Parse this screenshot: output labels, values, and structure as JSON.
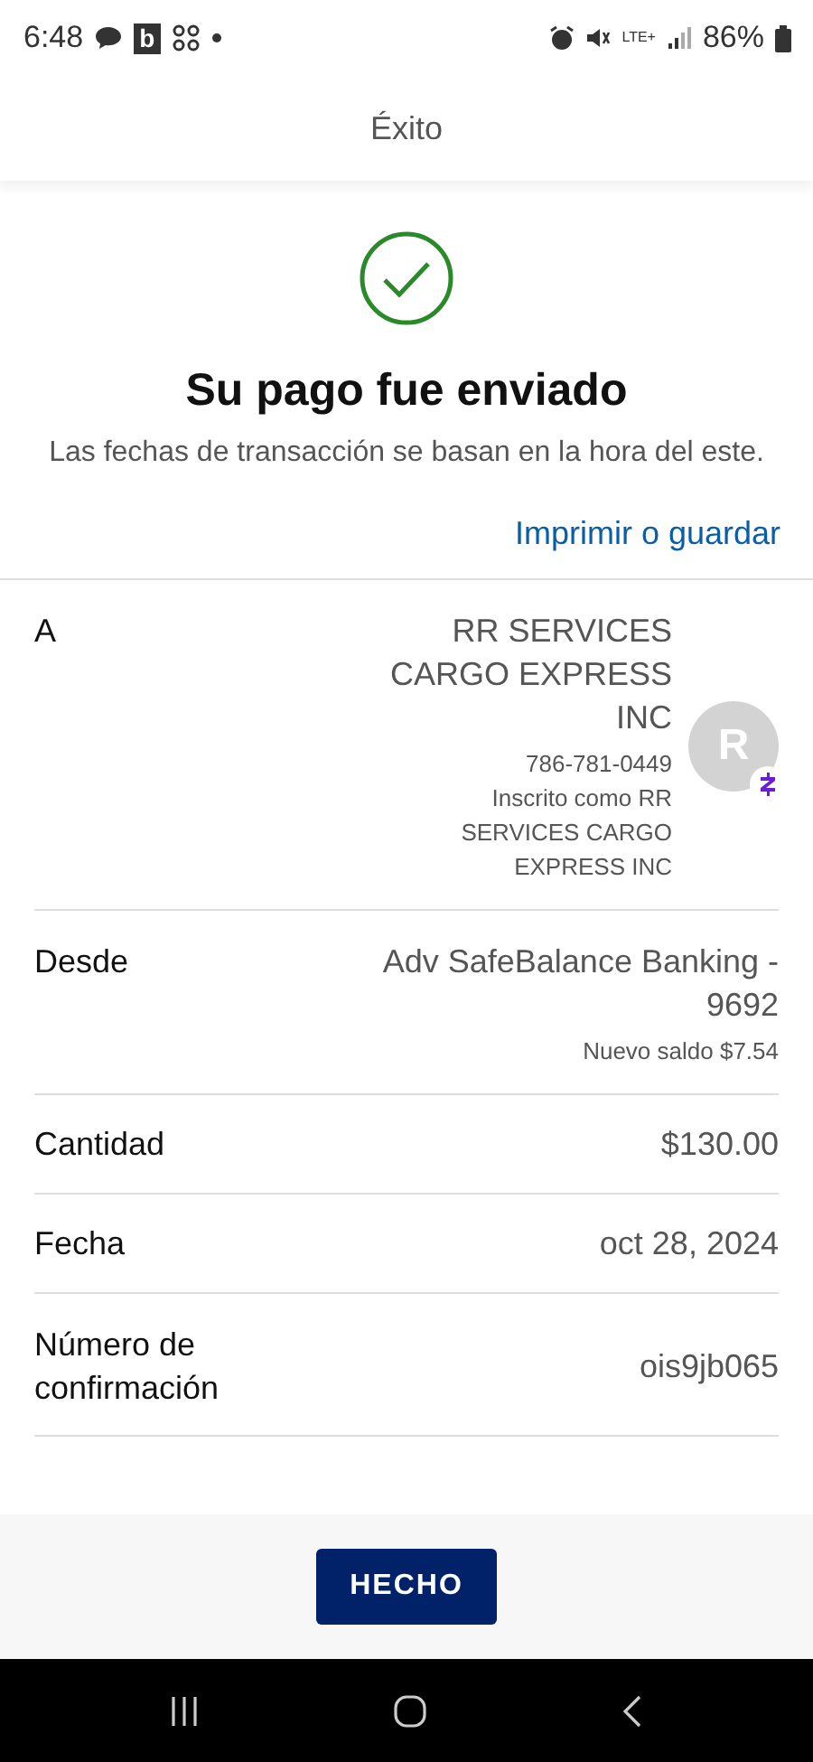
{
  "status_bar": {
    "time": "6:48",
    "app_badge": "b",
    "network": "LTE+",
    "battery": "86%"
  },
  "header": {
    "title": "Éxito"
  },
  "success": {
    "title": "Su pago fue enviado",
    "note": "Las fechas de transacción se basan en la hora del este.",
    "link": "Imprimir o guardar"
  },
  "details": [
    {
      "kind": "recipient",
      "label": "A",
      "name": "RR SERVICES CARGO EXPRESS INC",
      "phone": "786-781-0449",
      "enrolled": "Inscrito como RR SERVICES CARGO EXPRESS INC",
      "avatar": "R"
    },
    {
      "kind": "account",
      "label": "Desde",
      "value": "Adv SafeBalance Banking - 9692",
      "sub": "Nuevo saldo $7.54"
    },
    {
      "kind": "plain",
      "label": "Cantidad",
      "value": "$130.00"
    },
    {
      "kind": "plain",
      "label": "Fecha",
      "value": "oct 28, 2024"
    },
    {
      "kind": "plain",
      "label": "Número de confirmación",
      "value": "ois9jb065"
    }
  ],
  "footer": {
    "button": "HECHO"
  }
}
